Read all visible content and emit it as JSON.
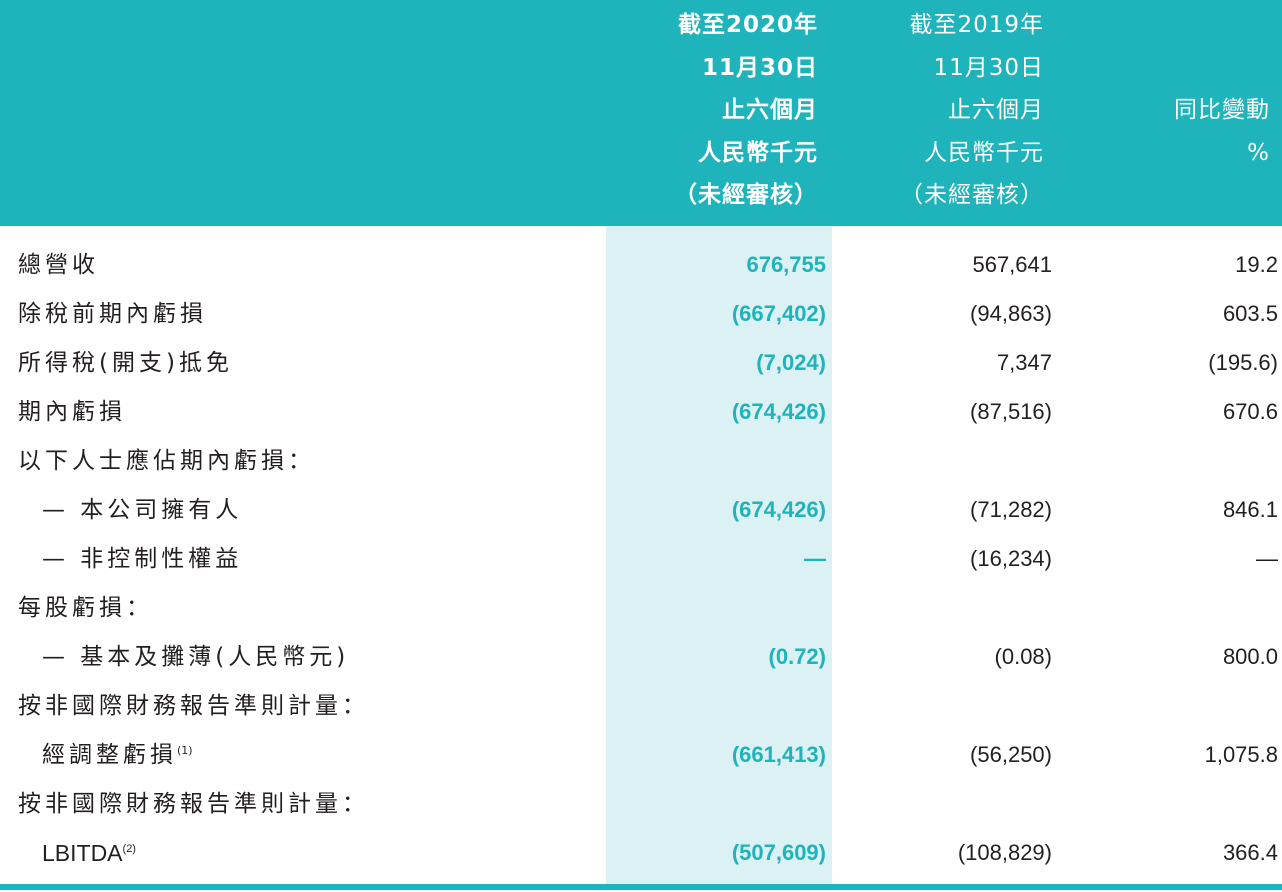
{
  "header": {
    "col1": [
      "截至2020年",
      "11月30日",
      "止六個月",
      "人民幣千元",
      "（未經審核）"
    ],
    "col2": [
      "截至2019年",
      "11月30日",
      "止六個月",
      "人民幣千元",
      "（未經審核）"
    ],
    "col3": [
      "同比變動",
      "%"
    ]
  },
  "colors": {
    "accent": "#1fb3bb",
    "shade": "#dcf1f3"
  },
  "rows": [
    {
      "label": "總營收",
      "v2020": "676,755",
      "v2019": "567,641",
      "yoy": "19.2"
    },
    {
      "label": "除稅前期內虧損",
      "v2020": "(667,402)",
      "v2019": "(94,863)",
      "yoy": "603.5"
    },
    {
      "label": "所得稅(開支)抵免",
      "v2020": "(7,024)",
      "v2019": "7,347",
      "yoy": "(195.6)"
    },
    {
      "label": "期內虧損",
      "v2020": "(674,426)",
      "v2019": "(87,516)",
      "yoy": "670.6"
    },
    {
      "label": "以下人士應佔期內虧損：",
      "v2020": "",
      "v2019": "",
      "yoy": ""
    },
    {
      "label": "— 本公司擁有人",
      "v2020": "(674,426)",
      "v2019": "(71,282)",
      "yoy": "846.1"
    },
    {
      "label": "— 非控制性權益",
      "v2020": "—",
      "v2019": "(16,234)",
      "yoy": "—"
    },
    {
      "label": "每股虧損：",
      "v2020": "",
      "v2019": "",
      "yoy": ""
    },
    {
      "label": "— 基本及攤薄(人民幣元)",
      "v2020": "(0.72)",
      "v2019": "(0.08)",
      "yoy": "800.0"
    },
    {
      "label": "按非國際財務報告準則計量：",
      "v2020": "",
      "v2019": "",
      "yoy": ""
    },
    {
      "label": "經調整虧損",
      "note": "(1)",
      "v2020": "(661,413)",
      "v2019": "(56,250)",
      "yoy": "1,075.8"
    },
    {
      "label": "按非國際財務報告準則計量：",
      "v2020": "",
      "v2019": "",
      "yoy": ""
    },
    {
      "label": "LBITDA",
      "note": "(2)",
      "v2020": "(507,609)",
      "v2019": "(108,829)",
      "yoy": "366.4"
    }
  ]
}
